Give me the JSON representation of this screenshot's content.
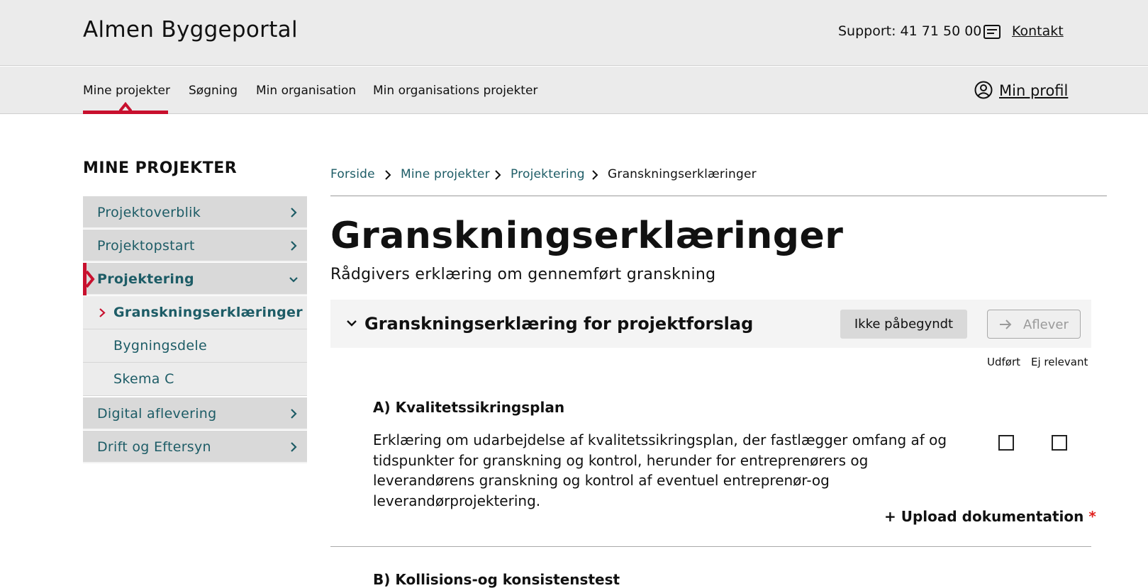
{
  "header": {
    "brand": "Almen Byggeportal",
    "support": "Support: 41 71 50 00",
    "contact_icon": "message-icon",
    "contact": "Kontakt"
  },
  "nav": {
    "items": [
      "Mine projekter",
      "Søgning",
      "Min organisation",
      "Min organisations projekter"
    ],
    "active": "Mine projekter",
    "profile_icon": "user-circle-icon",
    "profile": "Min profil"
  },
  "sidebar": {
    "title": "MINE PROJEKTER",
    "items": [
      {
        "label": "Projektoverblik"
      },
      {
        "label": "Projektopstart"
      },
      {
        "label": "Projektering"
      },
      {
        "label": "Digital aflevering"
      },
      {
        "label": "Drift og Eftersyn"
      }
    ],
    "subitems": [
      {
        "label": "Granskningserklæringer"
      },
      {
        "label": "Bygningsdele"
      },
      {
        "label": "Skema C"
      }
    ]
  },
  "breadcrumb": [
    "Forside",
    "Mine projekter",
    "Projektering",
    "Granskningserklæringer"
  ],
  "page": {
    "title": "Granskningserklæringer",
    "subtitle": "Rådgivers erklæring om gennemført granskning"
  },
  "section": {
    "title": "Granskningserklæring for projektforslag",
    "status": "Ikke påbegyndt",
    "deliver": "Aflever",
    "col_done": "Udført",
    "col_na": "Ej relevant"
  },
  "items": [
    {
      "heading": "A) Kvalitetssikringsplan",
      "text": "Erklæring om udarbejdelse af kvalitetssikringsplan, der fastlægger omfang af og tidspunkter for granskning og kontrol, herunder for entreprenørers og leverandørens granskning og kontrol af eventuel entreprenør-og leverandørprojektering.",
      "upload": "+ Upload dokumentation",
      "required_mark": "*"
    },
    {
      "heading": "B) Kollisions-og konsistenstest"
    }
  ],
  "colors": {
    "accent": "#c8102e",
    "link": "#1d5c66",
    "header_bg": "#ebebeb"
  }
}
